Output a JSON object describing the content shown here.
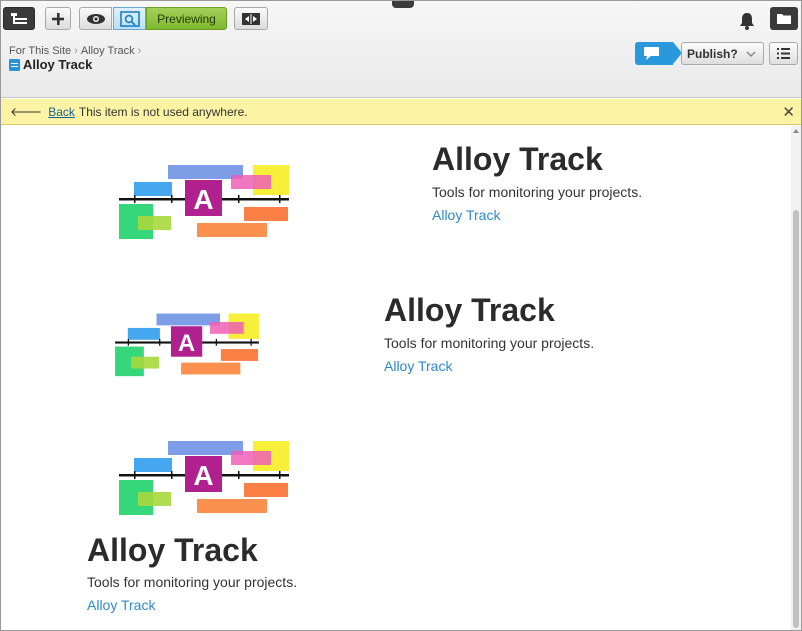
{
  "toolbar": {
    "preview_label": "Previewing",
    "icons": [
      "sitetree-icon",
      "add-icon",
      "eye-icon",
      "preview-icon",
      "compare-icon",
      "bell-icon",
      "folder-icon"
    ]
  },
  "context": {
    "breadcrumb": [
      "For This Site",
      "Alloy Track"
    ],
    "page_name": "Alloy Track",
    "publish_label": "Publish?"
  },
  "notice": {
    "back_label": "Back",
    "message": "This item is not used anywhere."
  },
  "blocks": [
    {
      "title": "Alloy Track",
      "description": "Tools for monitoring your projects.",
      "link": "Alloy Track"
    },
    {
      "title": "Alloy Track",
      "description": "Tools for monitoring your projects.",
      "link": "Alloy Track"
    },
    {
      "title": "Alloy Track",
      "description": "Tools for monitoring your projects.",
      "link": "Alloy Track"
    }
  ],
  "colors": {
    "accent_green": "#8dc63f",
    "accent_blue": "#2a98dc",
    "notice_yellow": "#fcf4a4",
    "link_blue": "#2e8ac5"
  }
}
